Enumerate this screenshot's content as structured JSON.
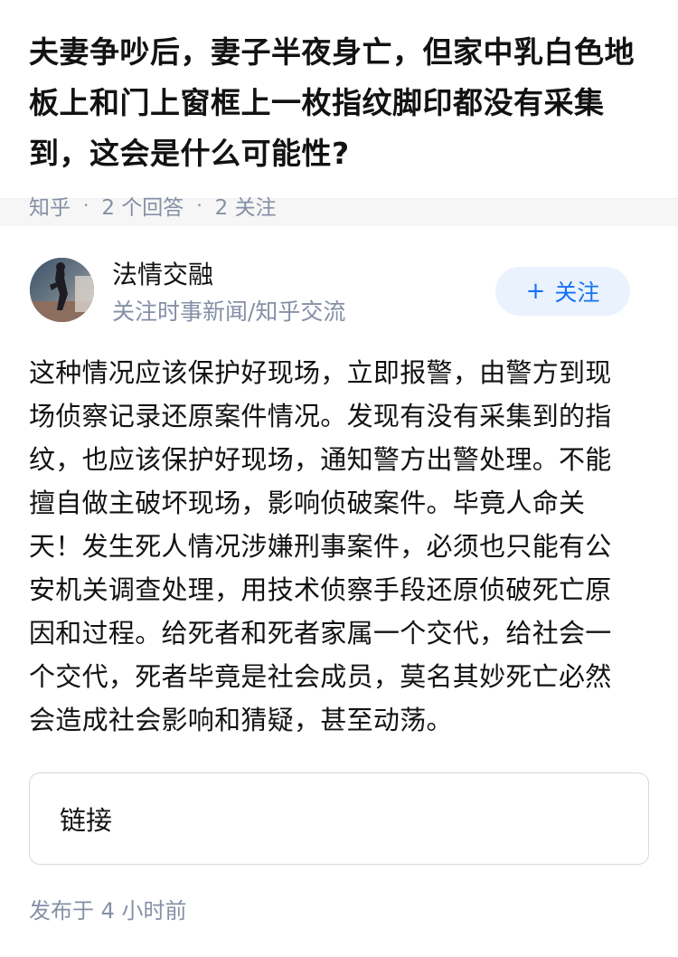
{
  "question": {
    "title": "夫妻争吵后，妻子半夜身亡，但家中乳白色地板上和门上窗框上一枚指纹脚印都没有采集到，这会是什么可能性?",
    "source": "知乎",
    "answer_count": "2 个回答",
    "follower_count": "2 关注"
  },
  "author": {
    "name": "法情交融",
    "headline": "关注时事新闻/知乎交流",
    "follow_label": "关注",
    "follow_icon": "plus-icon"
  },
  "answer": {
    "content": "这种情况应该保护好现场，立即报警，由警方到现场侦察记录还原案件情况。发现有没有采集到的指纹，也应该保护好现场，通知警方出警处理。不能擅自做主破坏现场，影响侦破案件。毕竟人命关天！发生死人情况涉嫌刑事案件，必须也只能有公安机关调查处理，用技术侦察手段还原侦破死亡原因和过程。给死者和死者家属一个交代，给社会一个交代，死者毕竟是社会成员，莫名其妙死亡必然会造成社会影响和猜疑，甚至动荡。",
    "link_label": "链接",
    "publish_time": "发布于  4 小时前"
  },
  "colors": {
    "text_primary": "#121212",
    "text_secondary": "#8590a6",
    "accent": "#1772f6",
    "accent_bg": "#eaf2fd",
    "divider": "#f6f6f6"
  }
}
